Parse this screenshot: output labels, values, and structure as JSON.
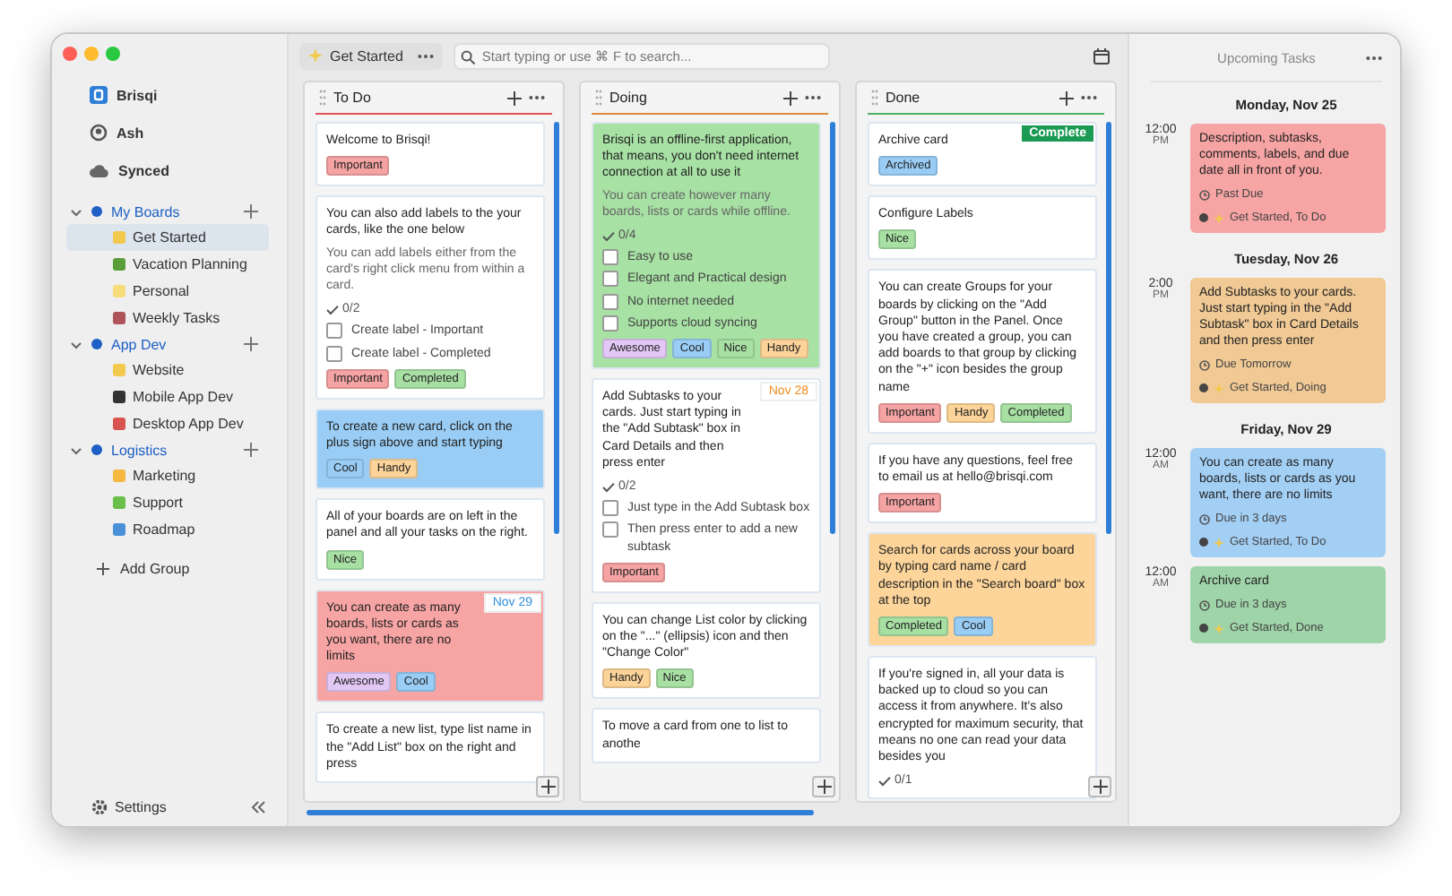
{
  "sidebar": {
    "app_name": "Brisqi",
    "user": "Ash",
    "sync_status": "Synced",
    "groups": [
      {
        "name": "My Boards",
        "expanded": true,
        "boards": [
          {
            "name": "Get Started",
            "selected": true,
            "color": "#f2c94c"
          },
          {
            "name": "Vacation Planning",
            "selected": false,
            "color": "#5a9e3a"
          },
          {
            "name": "Personal",
            "selected": false,
            "color": "#f7dc7a"
          },
          {
            "name": "Weekly Tasks",
            "selected": false,
            "color": "#b0545c"
          }
        ]
      },
      {
        "name": "App Dev",
        "expanded": true,
        "boards": [
          {
            "name": "Website",
            "selected": false,
            "color": "#f2c94c"
          },
          {
            "name": "Mobile App Dev",
            "selected": false,
            "color": "#333333"
          },
          {
            "name": "Desktop App Dev",
            "selected": false,
            "color": "#d9534f"
          }
        ]
      },
      {
        "name": "Logistics",
        "expanded": true,
        "boards": [
          {
            "name": "Marketing",
            "selected": false,
            "color": "#f5b942"
          },
          {
            "name": "Support",
            "selected": false,
            "color": "#6abf4b"
          },
          {
            "name": "Roadmap",
            "selected": false,
            "color": "#4a90d9"
          }
        ]
      }
    ],
    "add_group": "Add Group",
    "settings": "Settings"
  },
  "toolbar": {
    "tab": "Get Started",
    "search": {
      "placeholder": "Start typing or use ⌘ F to search..."
    }
  },
  "lists": [
    {
      "title": "To Do",
      "color": "#e0505a",
      "cards": [
        {
          "text": "Welcome to Brisqi!",
          "labels": [
            {
              "text": "Important",
              "color": "#f5a3a3"
            }
          ]
        },
        {
          "text": "You can also add labels to the your cards, like the one below",
          "note": "You can add labels either from the card's right click menu from within a card.",
          "progress": "0/2",
          "subtasks": [
            {
              "text": "Create label - Important",
              "checked": false
            },
            {
              "text": "Create label - Completed",
              "checked": false
            }
          ],
          "labels": [
            {
              "text": "Important",
              "color": "#f5a3a3"
            },
            {
              "text": "Completed",
              "color": "#a8e0a4"
            }
          ]
        },
        {
          "text": "To create a new card, click on the plus sign above and start typing",
          "color": "#99cdf5",
          "labels": [
            {
              "text": "Cool",
              "color": "#99cdf5"
            },
            {
              "text": "Handy",
              "color": "#fcd49a"
            }
          ]
        },
        {
          "text": "All of your boards are on left in the panel and all your tasks on the right.",
          "labels": [
            {
              "text": "Nice",
              "color": "#a8e0a4"
            }
          ]
        },
        {
          "text": "You can create as many boards, lists or cards as you want, there are no limits",
          "color": "#f7a4a4",
          "date": {
            "text": "Nov 29",
            "color": "#2f8fe0"
          },
          "labels": [
            {
              "text": "Awesome",
              "color": "#e3c8f5"
            },
            {
              "text": "Cool",
              "color": "#99cdf5"
            }
          ]
        },
        {
          "text": "To create a new list, type list name in the \"Add List\" box on the right and press"
        }
      ]
    },
    {
      "title": "Doing",
      "color": "#e08a3c",
      "cards": [
        {
          "text": "Brisqi is an offline-first application, that means, you don't need internet connection at all to use it",
          "color": "#a7e1a4",
          "note": "You can create however many boards, lists or cards while offline.",
          "progress": "0/4",
          "subtasks": [
            {
              "text": "Easy to use",
              "checked": false
            },
            {
              "text": "Elegant and Practical design",
              "checked": false
            },
            {
              "text": "No internet needed",
              "checked": false
            },
            {
              "text": "Supports cloud syncing",
              "checked": false
            }
          ],
          "labels": [
            {
              "text": "Awesome",
              "color": "#e3c8f5"
            },
            {
              "text": "Cool",
              "color": "#99cdf5"
            },
            {
              "text": "Nice",
              "color": "#a8e0a4"
            },
            {
              "text": "Handy",
              "color": "#fcd49a"
            }
          ]
        },
        {
          "text": "Add Subtasks to your cards. Just start typing in the \"Add Subtask\" box in Card Details and then press enter",
          "date": {
            "text": "Nov 28",
            "color": "#f08c1a"
          },
          "progress": "0/2",
          "subtasks": [
            {
              "text": "Just type in the Add Subtask box",
              "checked": false
            },
            {
              "text": "Then press enter to add a new subtask",
              "checked": false
            }
          ],
          "labels": [
            {
              "text": "Important",
              "color": "#f5a3a3"
            }
          ]
        },
        {
          "text": "You can change List color by clicking on the \"...\" (ellipsis) icon and then \"Change Color\"",
          "labels": [
            {
              "text": "Handy",
              "color": "#fcd49a"
            },
            {
              "text": "Nice",
              "color": "#a8e0a4"
            }
          ]
        },
        {
          "text": "To move a card from one to list to anothe"
        }
      ]
    },
    {
      "title": "Done",
      "color": "#4caf63",
      "cards": [
        {
          "text": "Archive card",
          "status": "Complete",
          "labels": [
            {
              "text": "Archived",
              "color": "#99cdf5"
            }
          ]
        },
        {
          "text": "Configure Labels",
          "labels": [
            {
              "text": "Nice",
              "color": "#a8e0a4"
            }
          ]
        },
        {
          "text": "You can create Groups for your boards by clicking on the \"Add Group\" button in the Panel. Once you have created a group, you can add boards to that group by clicking on the \"+\" icon besides the group name",
          "labels": [
            {
              "text": "Important",
              "color": "#f5a3a3"
            },
            {
              "text": "Handy",
              "color": "#fcd49a"
            },
            {
              "text": "Completed",
              "color": "#a8e0a4"
            }
          ]
        },
        {
          "text": "If you have any questions, feel free to email us at hello@brisqi.com",
          "labels": [
            {
              "text": "Important",
              "color": "#f5a3a3"
            }
          ]
        },
        {
          "text": "Search for cards across your board by typing card name / card description in the \"Search board\" box at the top",
          "color": "#fdd59a",
          "labels": [
            {
              "text": "Completed",
              "color": "#a8e0a4"
            },
            {
              "text": "Cool",
              "color": "#99cdf5"
            }
          ]
        },
        {
          "text": "If you're signed in, all your data is backed up to cloud so you can access it from anywhere. It's also encrypted for maximum security, that means no one can read your data besides you",
          "progress": "0/1"
        }
      ]
    }
  ],
  "upcoming": {
    "title": "Upcoming Tasks",
    "days": [
      {
        "date": "Monday, Nov 25",
        "tasks": [
          {
            "time": "12:00",
            "period": "PM",
            "text": "Description, subtasks, comments, labels, and due date all in front of you.",
            "due": "Past Due",
            "board": "Get Started, To Do",
            "color": "#f7a4a4"
          }
        ]
      },
      {
        "date": "Tuesday, Nov 26",
        "tasks": [
          {
            "time": "2:00",
            "period": "PM",
            "text": "Add Subtasks to your cards. Just start typing in the \"Add Subtask\" box in Card Details and then press enter",
            "due": "Due Tomorrow",
            "board": "Get Started, Doing",
            "color": "#f0c995"
          }
        ]
      },
      {
        "date": "Friday, Nov 29",
        "tasks": [
          {
            "time": "12:00",
            "period": "AM",
            "text": "You can create as many boards, lists or cards as you want, there are no limits",
            "due": "Due in 3 days",
            "board": "Get Started, To Do",
            "color": "#a3cff5"
          },
          {
            "time": "12:00",
            "period": "AM",
            "text": "Archive card",
            "due": "Due in 3 days",
            "board": "Get Started, Done",
            "color": "#9fd4a9"
          }
        ]
      }
    ]
  }
}
